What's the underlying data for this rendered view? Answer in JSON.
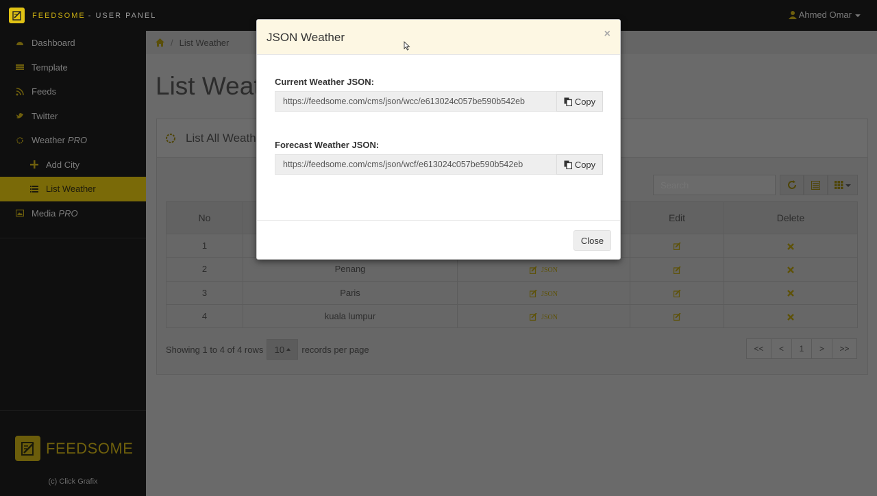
{
  "topbar": {
    "brand": "FEEDSOME",
    "brand_sub": "- USER PANEL",
    "user": "Ahmed Omar"
  },
  "sidebar": {
    "items": [
      {
        "label": "Dashboard",
        "icon": "dashboard-icon"
      },
      {
        "label": "Template",
        "icon": "list-icon"
      },
      {
        "label": "Feeds",
        "icon": "rss-icon"
      },
      {
        "label": "Twitter",
        "icon": "twitter-icon"
      },
      {
        "label": "Weather",
        "suffix": "PRO",
        "icon": "sun-icon"
      },
      {
        "label": "Add City",
        "icon": "plus-icon"
      },
      {
        "label": "List Weather",
        "icon": "list-icon",
        "active": true
      },
      {
        "label": "Media",
        "suffix": "PRO",
        "icon": "image-icon"
      }
    ],
    "logo_text": "FEEDSOME",
    "copyright": "(c) Click Grafix"
  },
  "breadcrumb": {
    "current": "List Weather"
  },
  "page": {
    "title": "List Weat",
    "panel_title": "List All Weath"
  },
  "table": {
    "search_placeholder": "Search",
    "headers": [
      "No",
      "",
      "",
      "Edit",
      "Delete"
    ],
    "rows": [
      {
        "no": "1",
        "city": "",
        "json": ""
      },
      {
        "no": "2",
        "city": "Penang",
        "json": "JSON"
      },
      {
        "no": "3",
        "city": "Paris",
        "json": "JSON"
      },
      {
        "no": "4",
        "city": "kuala lumpur",
        "json": "JSON"
      }
    ],
    "showing": "Showing 1 to 4 of 4 rows",
    "page_size": "10",
    "per_page": "records per page",
    "pagination": [
      "<<",
      "<",
      "1",
      ">",
      ">>"
    ]
  },
  "modal": {
    "title": "JSON Weather",
    "close_x": "×",
    "current_label": "Current Weather JSON:",
    "current_url": "https://feedsome.com/cms/json/wcc/e613024c057be590b542eb",
    "forecast_label": "Forecast Weather JSON:",
    "forecast_url": "https://feedsome.com/cms/json/wcf/e613024c057be590b542eb",
    "copy_label": "Copy",
    "close_label": "Close"
  },
  "colors": {
    "accent": "#e0c214",
    "sidebar_bg": "#0f0f0f",
    "active_item": "#7a6a08",
    "modal_header": "#fdf7e3"
  }
}
